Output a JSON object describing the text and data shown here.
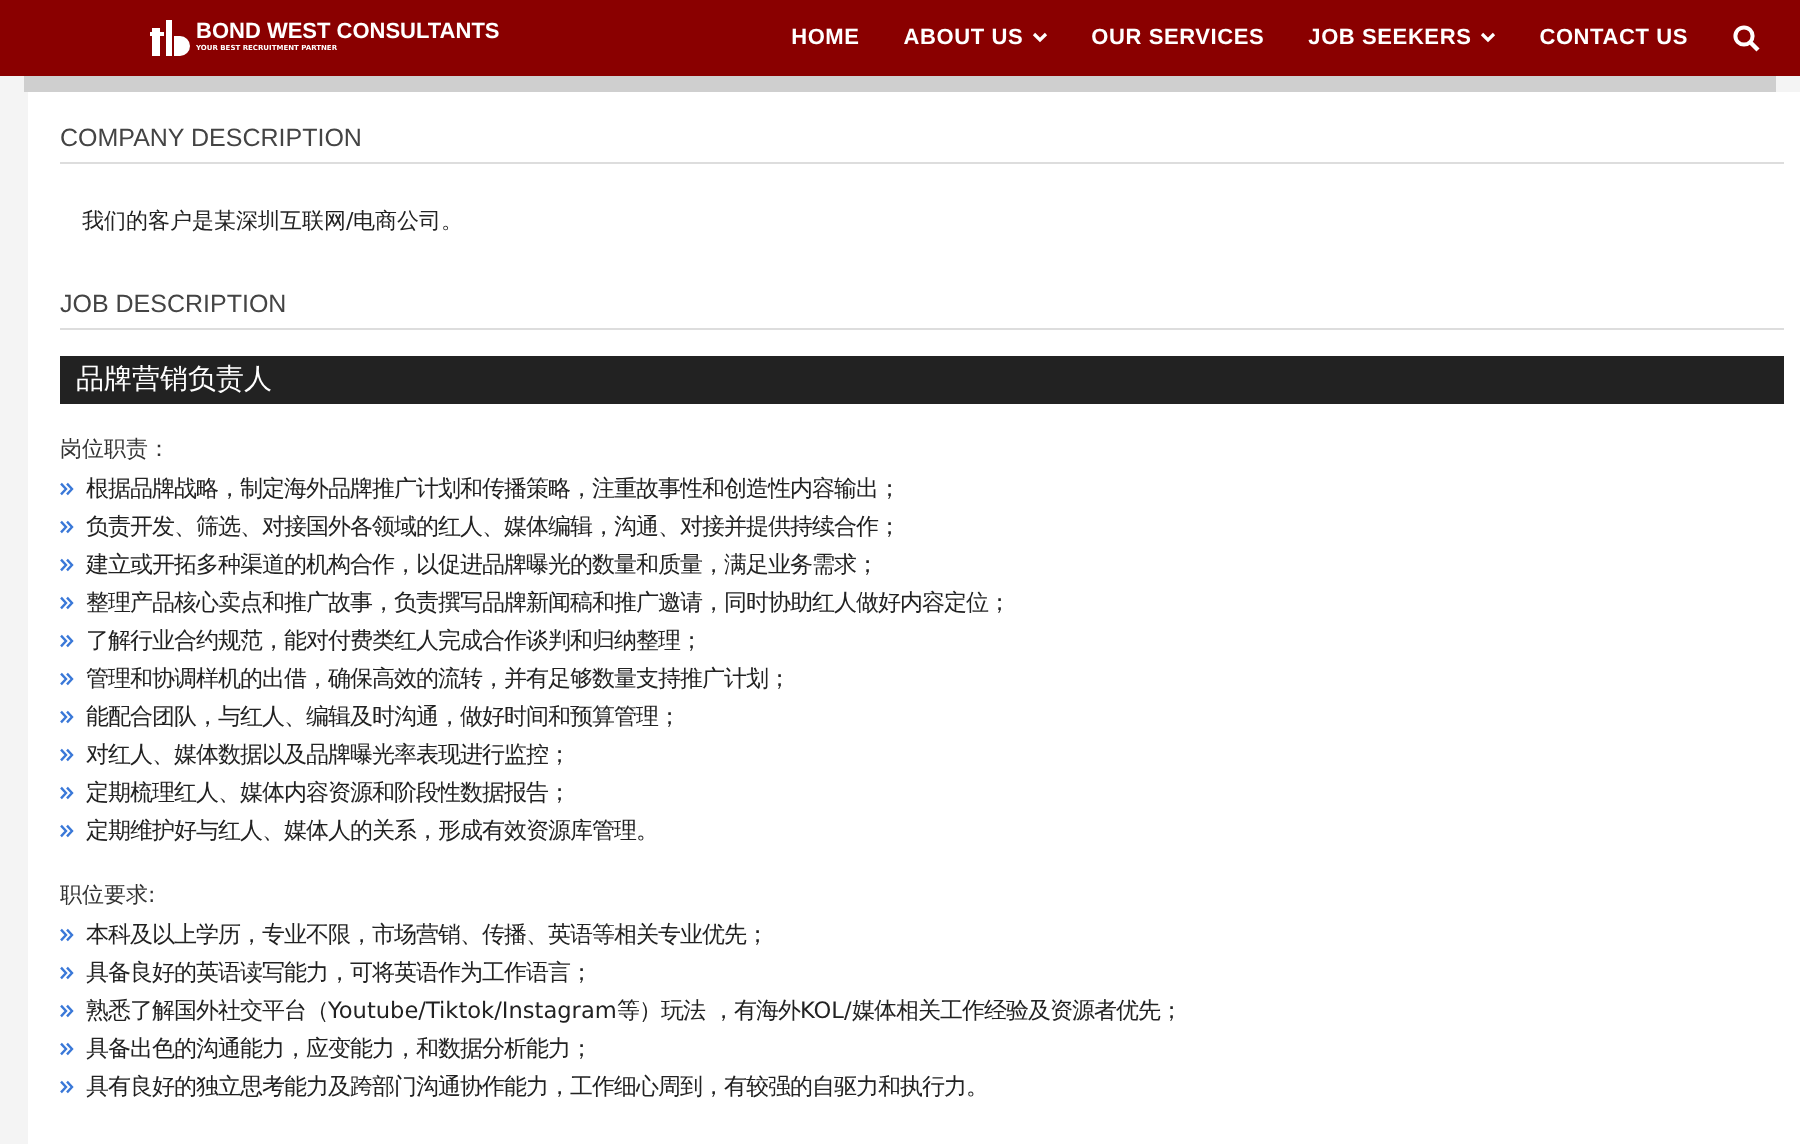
{
  "header": {
    "logo": "BOND WEST CONSULTANTS",
    "tagline": "YOUR BEST RECRUITMENT PARTNER",
    "nav": [
      {
        "label": "HOME",
        "dropdown": false
      },
      {
        "label": "ABOUT US",
        "dropdown": true
      },
      {
        "label": "OUR SERVICES",
        "dropdown": false
      },
      {
        "label": "JOB SEEKERS",
        "dropdown": true
      },
      {
        "label": "CONTACT US",
        "dropdown": false
      }
    ]
  },
  "company": {
    "heading": "COMPANY DESCRIPTION",
    "text": "我们的客户是某深圳互联网/电商公司。"
  },
  "job": {
    "heading": "JOB DESCRIPTION",
    "title": "品牌营销负责人",
    "sections": [
      {
        "label": "岗位职责：",
        "items": [
          "根据品牌战略，制定海外品牌推广计划和传播策略，注重故事性和创造性内容输出；",
          "负责开发、筛选、对接国外各领域的红人、媒体编辑，沟通、对接并提供持续合作；",
          "建立或开拓多种渠道的机构合作，以促进品牌曝光的数量和质量，满足业务需求；",
          "整理产品核心卖点和推广故事，负责撰写品牌新闻稿和推广邀请，同时协助红人做好内容定位；",
          "了解行业合约规范，能对付费类红人完成合作谈判和归纳整理；",
          "管理和协调样机的出借，确保高效的流转，并有足够数量支持推广计划；",
          "能配合团队，与红人、编辑及时沟通，做好时间和预算管理；",
          "对红人、媒体数据以及品牌曝光率表现进行监控；",
          "定期梳理红人、媒体内容资源和阶段性数据报告；",
          "定期维护好与红人、媒体人的关系，形成有效资源库管理。"
        ]
      },
      {
        "label": "职位要求:",
        "items": [
          "本科及以上学历，专业不限，市场营销、传播、英语等相关专业优先；",
          "具备良好的英语读写能力，可将英语作为工作语言；",
          "熟悉了解国外社交平台（Youtube/Tiktok/Instagram等）玩法 ，有海外KOL/媒体相关工作经验及资源者优先；",
          "具备出色的沟通能力，应变能力，和数据分析能力；",
          "具有良好的独立思考能力及跨部门沟通协作能力，工作细心周到，有较强的自驱力和执行力。"
        ]
      }
    ]
  }
}
